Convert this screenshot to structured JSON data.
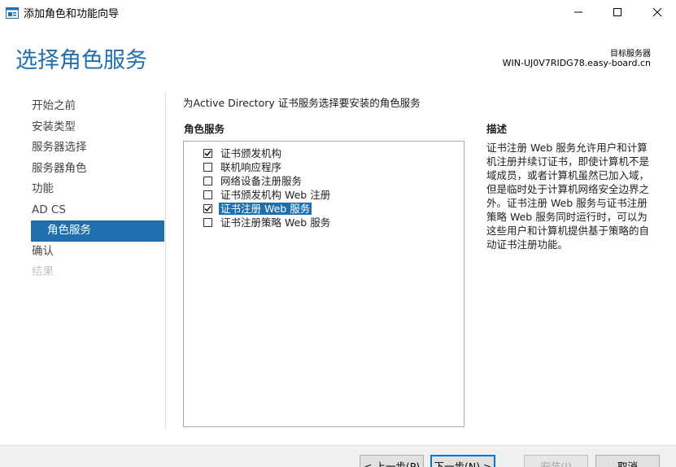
{
  "window": {
    "title": "添加角色和功能向导",
    "controls": [
      "minimize-icon",
      "maximize-icon",
      "close-icon"
    ]
  },
  "header": {
    "page_title": "选择角色服务",
    "server_label": "目标服务器",
    "server_name": "WIN-UJ0V7RIDG78.easy-board.cn"
  },
  "nav": {
    "items": [
      {
        "label": "开始之前",
        "state": "normal"
      },
      {
        "label": "安装类型",
        "state": "normal"
      },
      {
        "label": "服务器选择",
        "state": "normal"
      },
      {
        "label": "服务器角色",
        "state": "normal"
      },
      {
        "label": "功能",
        "state": "normal"
      },
      {
        "label": "AD CS",
        "state": "normal"
      },
      {
        "label": "角色服务",
        "state": "active"
      },
      {
        "label": "确认",
        "state": "normal"
      },
      {
        "label": "结果",
        "state": "disabled"
      }
    ]
  },
  "main": {
    "instruction": "为Active Directory 证书服务选择要安装的角色服务",
    "roles_header": "角色服务",
    "roles": [
      {
        "label": "证书颁发机构",
        "checked": true,
        "selected": false
      },
      {
        "label": "联机响应程序",
        "checked": false,
        "selected": false
      },
      {
        "label": "网络设备注册服务",
        "checked": false,
        "selected": false
      },
      {
        "label": "证书颁发机构 Web 注册",
        "checked": false,
        "selected": false
      },
      {
        "label": "证书注册 Web 服务",
        "checked": true,
        "selected": true
      },
      {
        "label": "证书注册策略 Web 服务",
        "checked": false,
        "selected": false
      }
    ],
    "description_header": "描述",
    "description_lines": [
      "证书注册 Web 服务允许用户和计算",
      "机注册并续订证书，即使计算机不是",
      "域成员，或者计算机虽然已加入域，",
      "但是临时处于计算机网络安全边界之",
      "外。证书注册 Web 服务与证书注册",
      "策略 Web 服务同时运行时，可以为",
      "这些用户和计算机提供基于策略的自",
      "动证书注册功能。"
    ]
  },
  "footer": {
    "prev_label": "< 上一步(P)",
    "next_label": "下一步(N) >",
    "install_label": "安装(I)",
    "cancel_label": "取消"
  },
  "colors": {
    "accent": "#1f6fae",
    "selection": "#1f6fae",
    "footer_bg": "#f0f0f0"
  }
}
